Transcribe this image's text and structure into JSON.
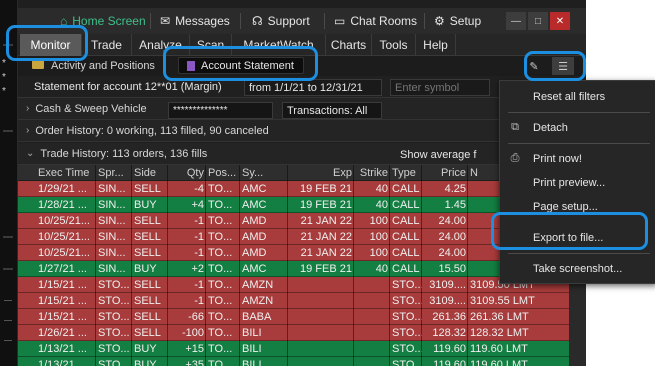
{
  "topbar": {
    "home": "Home Screen",
    "messages": "Messages",
    "support": "Support",
    "chat_rooms": "Chat Rooms",
    "setup": "Setup"
  },
  "tabs": [
    "Monitor",
    "Trade",
    "Analyze",
    "Scan",
    "MarketWatch",
    "Charts",
    "Tools",
    "Help"
  ],
  "subtabs": {
    "activity": "Activity and Positions",
    "statement": "Account Statement"
  },
  "statement": {
    "account": "Statement for account 12**01 (Margin)",
    "range": "from 1/1/21 to 12/31/21",
    "symbol_placeholder": "Enter symbol"
  },
  "cash_sweep": {
    "label": "Cash & Sweep Vehicle",
    "masked": "**************",
    "transactions": "Transactions: All"
  },
  "order_history": "Order History: 0 working, 113 filled, 90 canceled",
  "trade_history": {
    "label": "Trade History: 113 orders, 136 fills",
    "show_avg": "Show average f"
  },
  "table": {
    "headers": [
      "Exec Time",
      "Spr...",
      "Side",
      "Qty",
      "Pos...",
      "Sy...",
      "Exp",
      "Strike",
      "Type",
      "Price",
      "N"
    ],
    "rows": [
      {
        "color": "red",
        "cells": [
          "1/29/21 ...",
          "SIN...",
          "SELL",
          "-4",
          "TO...",
          "AMC",
          "19 FEB 21",
          "40",
          "CALL",
          "4.25",
          ""
        ]
      },
      {
        "color": "green",
        "cells": [
          "1/28/21 ...",
          "SIN...",
          "BUY",
          "+4",
          "TO...",
          "AMC",
          "19 FEB 21",
          "40",
          "CALL",
          "1.45",
          ""
        ]
      },
      {
        "color": "red",
        "cells": [
          "10/25/21...",
          "SIN...",
          "SELL",
          "-1",
          "TO...",
          "AMD",
          "21 JAN 22",
          "100",
          "CALL",
          "24.00",
          ""
        ]
      },
      {
        "color": "red",
        "cells": [
          "10/25/21...",
          "SIN...",
          "SELL",
          "-1",
          "TO...",
          "AMD",
          "21 JAN 22",
          "100",
          "CALL",
          "24.00",
          ""
        ]
      },
      {
        "color": "red",
        "cells": [
          "10/25/21...",
          "SIN...",
          "SELL",
          "-1",
          "TO...",
          "AMD",
          "21 JAN 22",
          "100",
          "CALL",
          "24.00",
          ""
        ]
      },
      {
        "color": "green",
        "cells": [
          "1/27/21 ...",
          "SIN...",
          "BUY",
          "+2",
          "TO...",
          "AMC",
          "19 FEB 21",
          "40",
          "CALL",
          "15.50",
          ""
        ]
      },
      {
        "color": "red",
        "cells": [
          "1/15/21 ...",
          "STO...",
          "SELL",
          "-1",
          "TO...",
          "AMZN",
          "",
          "",
          "STO...",
          "3109....",
          "3109.50 LMT"
        ]
      },
      {
        "color": "red",
        "cells": [
          "1/15/21 ...",
          "STO...",
          "SELL",
          "-1",
          "TO...",
          "AMZN",
          "",
          "",
          "STO...",
          "3109....",
          "3109.55 LMT"
        ]
      },
      {
        "color": "red",
        "cells": [
          "1/15/21 ...",
          "STO...",
          "SELL",
          "-66",
          "TO...",
          "BABA",
          "",
          "",
          "STO...",
          "261.36",
          "261.36 LMT"
        ]
      },
      {
        "color": "red",
        "cells": [
          "1/26/21 ...",
          "STO...",
          "SELL",
          "-100",
          "TO...",
          "BILI",
          "",
          "",
          "STO...",
          "128.32",
          "128.32 LMT"
        ]
      },
      {
        "color": "green",
        "cells": [
          "1/13/21 ...",
          "STO...",
          "BUY",
          "+15",
          "TO...",
          "BILI",
          "",
          "",
          "STO...",
          "119.60",
          "119.60 LMT"
        ]
      },
      {
        "color": "green",
        "cells": [
          "1/13/21 ...",
          "STO...",
          "BUY",
          "+35",
          "TO...",
          "BILI",
          "",
          "",
          "STO...",
          "119.60",
          "119.60 LMT"
        ]
      }
    ]
  },
  "menu": {
    "reset": "Reset all filters",
    "detach": "Detach",
    "print_now": "Print now!",
    "print_preview": "Print preview...",
    "page_setup": "Page setup...",
    "export": "Export to file...",
    "screenshot": "Take screenshot..."
  },
  "colors": {
    "sell_row": "#a83b3b",
    "buy_row": "#137f42",
    "highlight": "#1c8fe0",
    "home_accent": "#3fbf8a"
  }
}
